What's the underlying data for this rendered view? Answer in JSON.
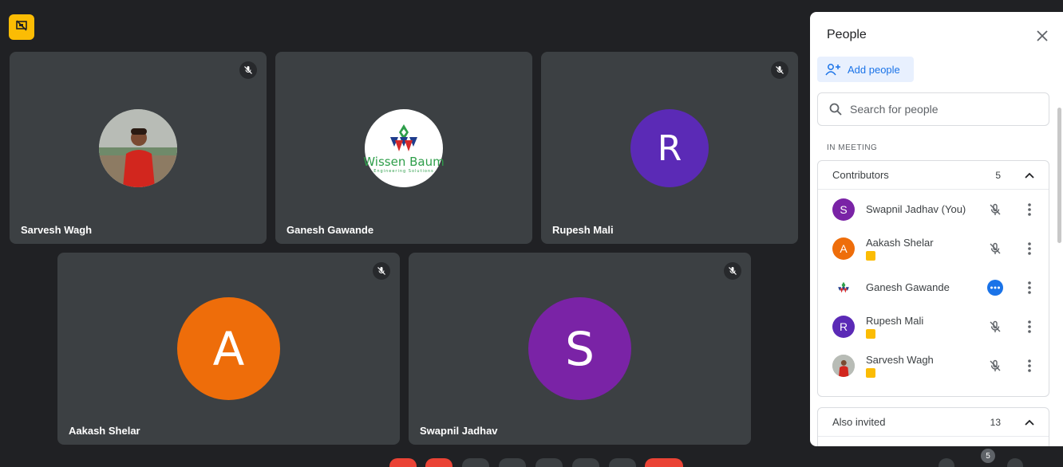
{
  "colors": {
    "background": "#202124",
    "tile": "#3c4043",
    "accent_blue": "#1a73e8",
    "badge_yellow": "#fbbc04",
    "end_call_red": "#ea4335"
  },
  "top_badge": {
    "icon": "presentation-off-icon"
  },
  "tiles": [
    {
      "name": "Sarvesh Wagh",
      "avatar_type": "photo",
      "muted": true
    },
    {
      "name": "Ganesh Gawande",
      "avatar_type": "logo",
      "logo_text": "Wissen Baum",
      "logo_sub": "Engineering Solutions",
      "muted": false
    },
    {
      "name": "Rupesh Mali",
      "avatar_type": "letter",
      "letter": "R",
      "color": "#5b2ab6",
      "muted": true
    },
    {
      "name": "Aakash Shelar",
      "avatar_type": "letter",
      "letter": "A",
      "color": "#ee6d0a",
      "muted": true
    },
    {
      "name": "Swapnil Jadhav",
      "avatar_type": "letter",
      "letter": "S",
      "color": "#7a23a6",
      "muted": true
    }
  ],
  "panel": {
    "title": "People",
    "add_people_label": "Add people",
    "search_placeholder": "Search for people",
    "section_label": "IN MEETING",
    "contributors": {
      "label": "Contributors",
      "count": "5",
      "people": [
        {
          "name": "Swapnil Jadhav (You)",
          "letter": "S",
          "color": "#7a23a6",
          "presenting": false,
          "status": "muted"
        },
        {
          "name": "Aakash Shelar",
          "letter": "A",
          "color": "#ee6d0a",
          "presenting": true,
          "status": "muted"
        },
        {
          "name": "Ganesh Gawande",
          "letter": "",
          "color": "#ffffff",
          "presenting": false,
          "status": "speaking"
        },
        {
          "name": "Rupesh Mali",
          "letter": "R",
          "color": "#5b2ab6",
          "presenting": true,
          "status": "muted"
        },
        {
          "name": "Sarvesh Wagh",
          "letter": "",
          "color": "#a0522d",
          "presenting": true,
          "status": "muted"
        }
      ]
    },
    "also_invited": {
      "label": "Also invited",
      "count": "13"
    }
  },
  "bottom": {
    "participant_count": "5"
  }
}
